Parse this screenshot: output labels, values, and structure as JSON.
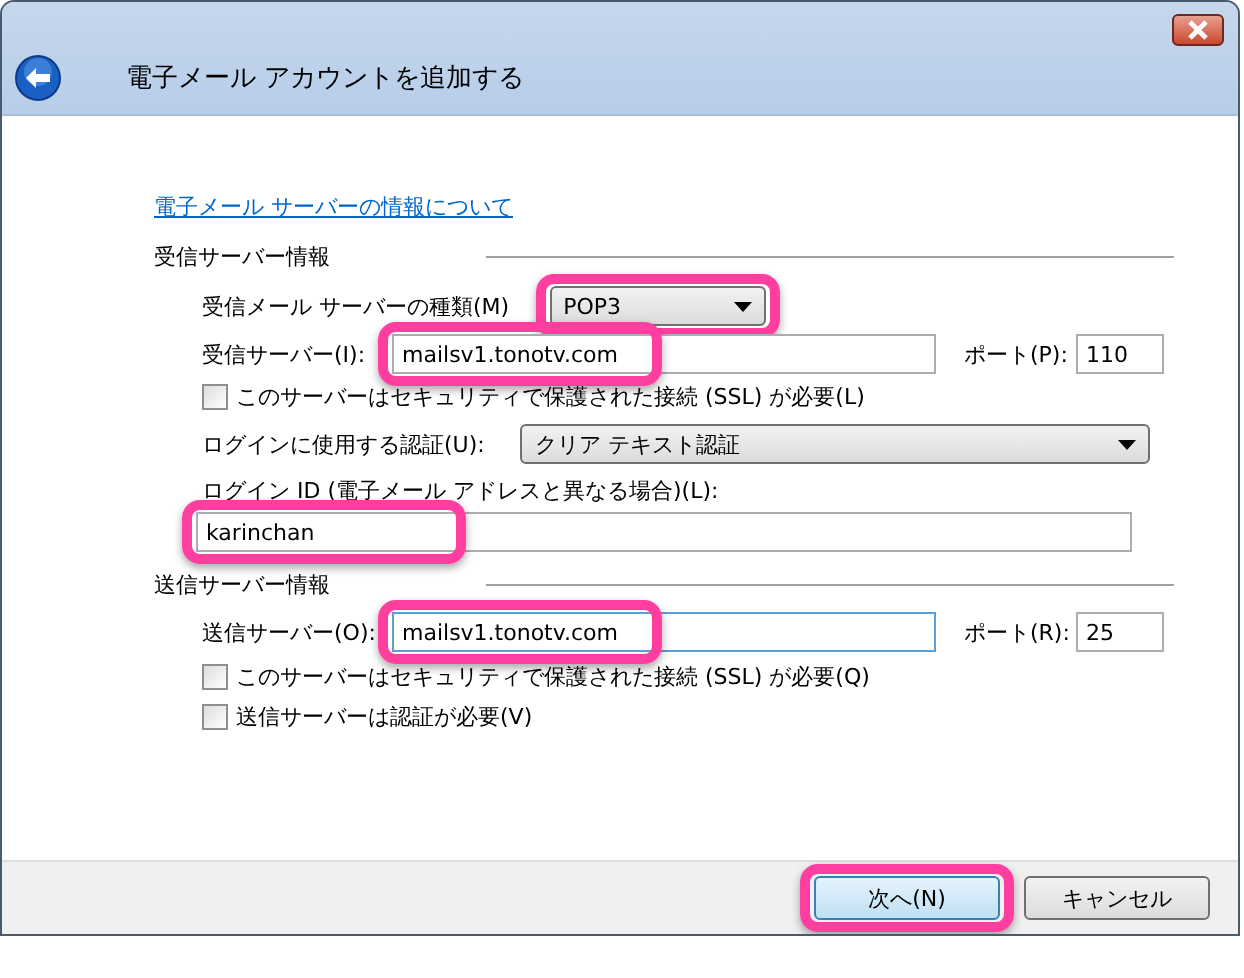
{
  "window": {
    "title": "電子メール アカウントを追加する"
  },
  "help_link": "電子メール サーバーの情報について",
  "incoming": {
    "heading": "受信サーバー情報",
    "server_type": {
      "label": "受信メール サーバーの種類(M)",
      "value": "POP3",
      "highlighted": true
    },
    "server": {
      "label": "受信サーバー(I):",
      "value": "mailsv1.tonotv.com",
      "highlighted": true
    },
    "port": {
      "label": "ポート(P):",
      "value": "110"
    },
    "ssl": {
      "label": "このサーバーはセキュリティで保護された接続 (SSL) が必要(L)",
      "checked": false
    },
    "auth": {
      "label": "ログインに使用する認証(U):",
      "value": "クリア テキスト認証"
    },
    "login_id": {
      "label": "ログイン ID (電子メール アドレスと異なる場合)(L):",
      "value": "karinchan",
      "highlighted": true
    }
  },
  "outgoing": {
    "heading": "送信サーバー情報",
    "server": {
      "label": "送信サーバー(O):",
      "value": "mailsv1.tonotv.com",
      "highlighted": true
    },
    "port": {
      "label": "ポート(R):",
      "value": "25"
    },
    "ssl": {
      "label": "このサーバーはセキュリティで保護された接続 (SSL) が必要(Q)",
      "checked": false
    },
    "auth_required": {
      "label": "送信サーバーは認証が必要(V)",
      "checked": false
    }
  },
  "buttons": [
    {
      "label": "次へ(N)",
      "highlighted": true
    },
    {
      "label": "キャンセル",
      "highlighted": false
    }
  ]
}
